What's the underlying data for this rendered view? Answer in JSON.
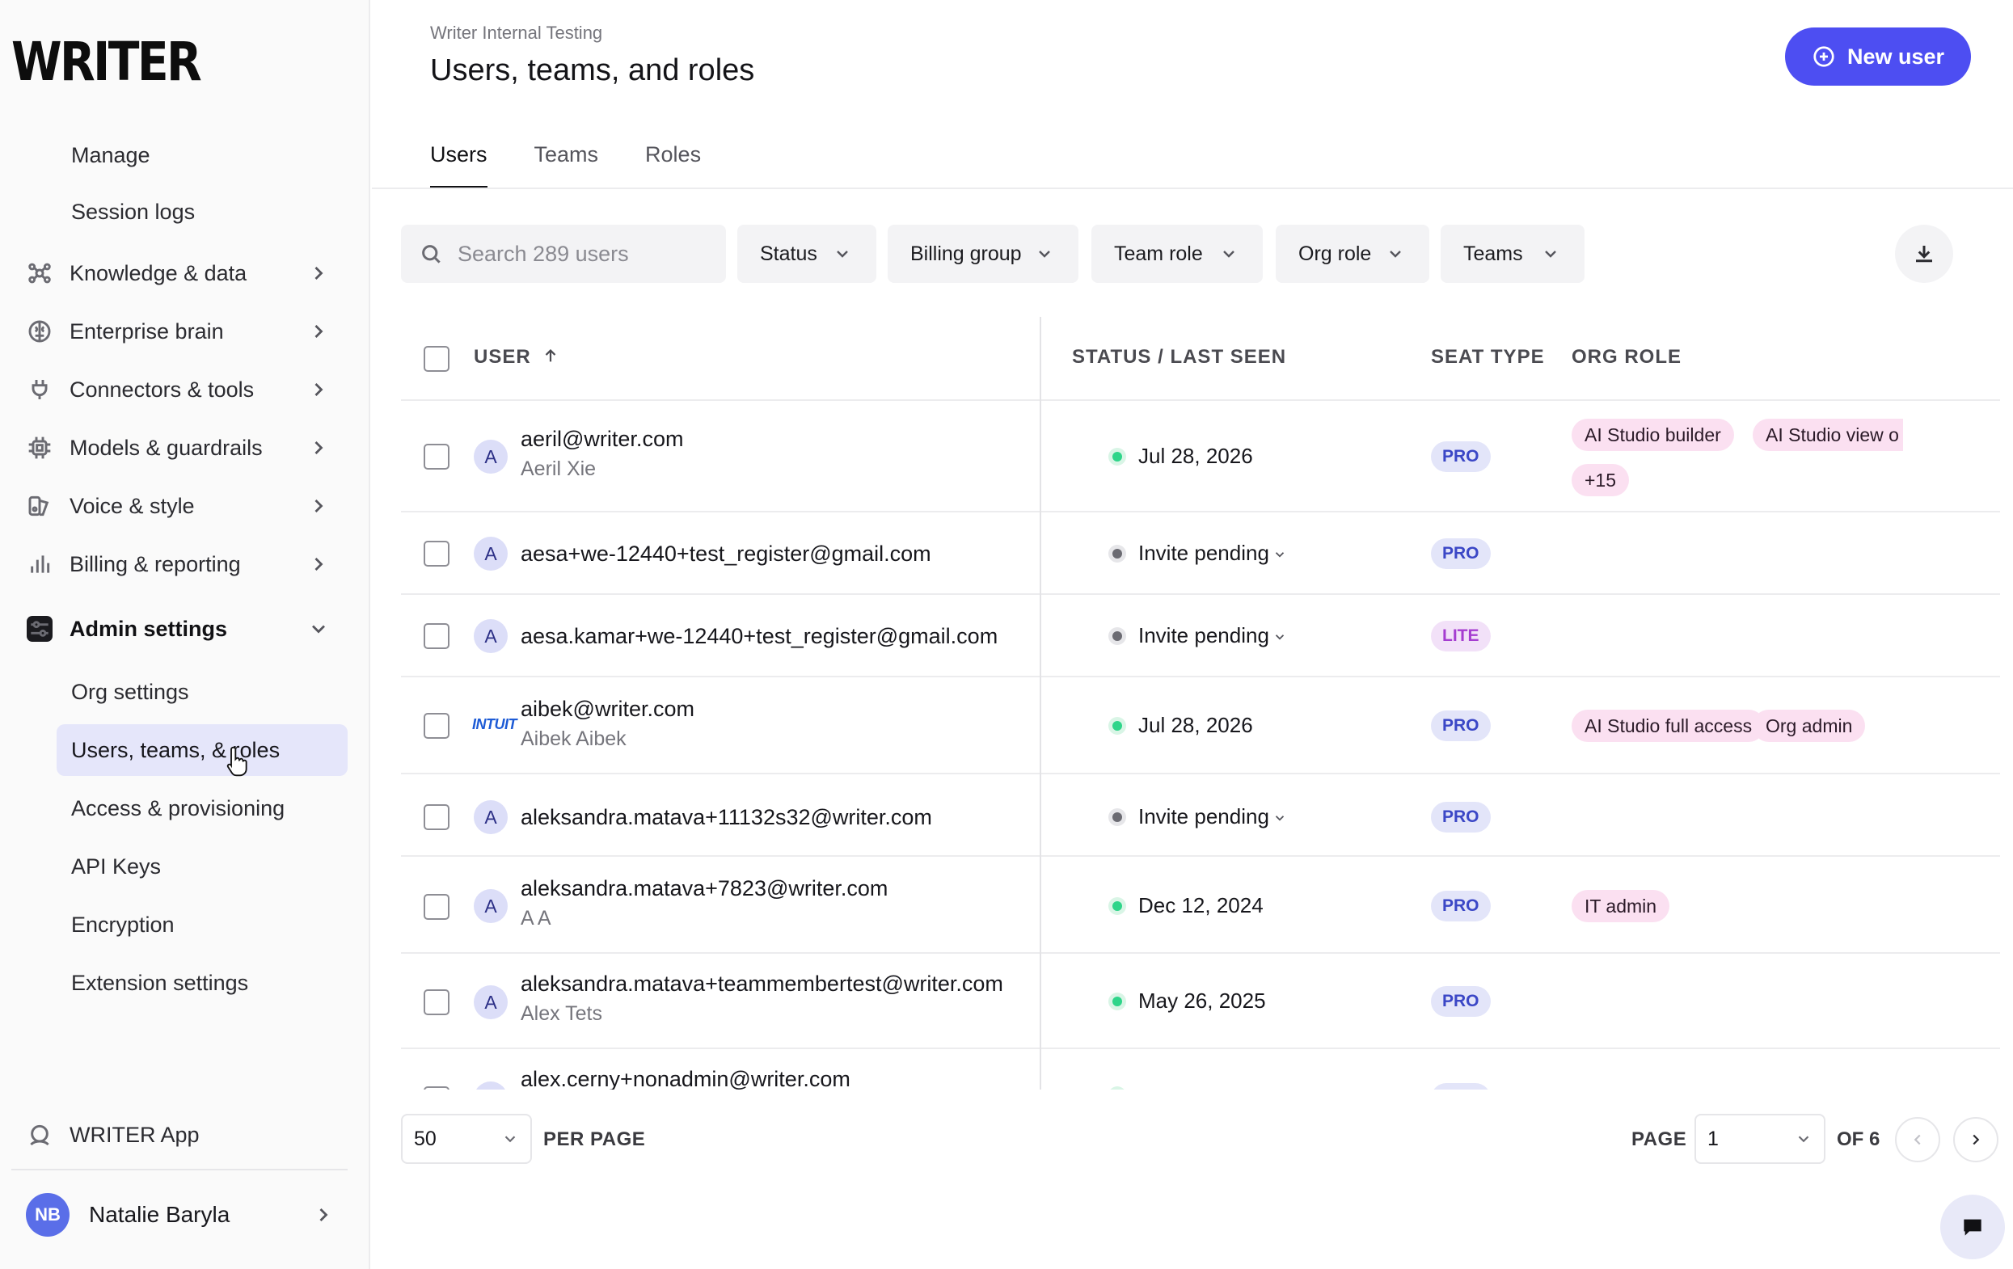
{
  "sidebar": {
    "logo": "WRITER",
    "items": [
      {
        "label": "Manage"
      },
      {
        "label": "Session logs"
      },
      {
        "label": "Knowledge & data",
        "icon": "knowledge-icon"
      },
      {
        "label": "Enterprise brain",
        "icon": "brain-icon"
      },
      {
        "label": "Connectors & tools",
        "icon": "plug-icon"
      },
      {
        "label": "Models & guardrails",
        "icon": "chip-icon"
      },
      {
        "label": "Voice & style",
        "icon": "voice-icon"
      },
      {
        "label": "Billing & reporting",
        "icon": "bar-chart-icon"
      },
      {
        "label": "Admin settings",
        "icon": "sliders-icon"
      }
    ],
    "admin_sub": [
      {
        "label": "Org settings"
      },
      {
        "label": "Users, teams, & roles",
        "active": true
      },
      {
        "label": "Access & provisioning"
      },
      {
        "label": "API Keys"
      },
      {
        "label": "Encryption"
      },
      {
        "label": "Extension settings"
      }
    ],
    "writer_app": "WRITER App",
    "user": {
      "initials": "NB",
      "name": "Natalie Baryla"
    }
  },
  "header": {
    "breadcrumb": "Writer Internal Testing",
    "title": "Users, teams, and roles",
    "new_user_label": "New user"
  },
  "tabs": [
    {
      "label": "Users",
      "active": true
    },
    {
      "label": "Teams"
    },
    {
      "label": "Roles"
    }
  ],
  "filters": {
    "search_placeholder": "Search 289 users",
    "status": "Status",
    "billing_group": "Billing group",
    "team_role": "Team role",
    "org_role": "Org role",
    "teams": "Teams"
  },
  "table": {
    "columns": {
      "user": "USER",
      "status": "STATUS / LAST SEEN",
      "seat": "SEAT TYPE",
      "org_role": "ORG ROLE"
    },
    "rows": [
      {
        "avatar": "A",
        "email": "aeril@writer.com",
        "name": "Aeril Xie",
        "status": "Jul 28, 2026",
        "state": "active",
        "seat": "PRO",
        "roles": [
          "AI Studio builder",
          "AI Studio view o",
          "+15"
        ]
      },
      {
        "avatar": "A",
        "email": "aesa+we-12440+test_register@gmail.com",
        "name": "",
        "status": "Invite pending",
        "state": "pending",
        "seat": "PRO",
        "roles": []
      },
      {
        "avatar": "A",
        "email": "aesa.kamar+we-12440+test_register@gmail.com",
        "name": "",
        "status": "Invite pending",
        "state": "pending",
        "seat": "LITE",
        "roles": []
      },
      {
        "avatar": "INTUIT",
        "email": "aibek@writer.com",
        "name": "Aibek Aibek",
        "status": "Jul 28, 2026",
        "state": "active",
        "seat": "PRO",
        "roles": [
          "AI Studio full access",
          "Org admin"
        ]
      },
      {
        "avatar": "A",
        "email": "aleksandra.matava+11132s32@writer.com",
        "name": "",
        "status": "Invite pending",
        "state": "pending",
        "seat": "PRO",
        "roles": []
      },
      {
        "avatar": "A",
        "email": "aleksandra.matava+7823@writer.com",
        "name": "A A",
        "status": "Dec 12, 2024",
        "state": "active",
        "seat": "PRO",
        "roles": [
          "IT admin"
        ]
      },
      {
        "avatar": "A",
        "email": "aleksandra.matava+teammembertest@writer.com",
        "name": "Alex Tets",
        "status": "May 26, 2025",
        "state": "active",
        "seat": "PRO",
        "roles": []
      },
      {
        "avatar": "A",
        "email": "alex.cerny+nonadmin@writer.com",
        "name": "",
        "status": "",
        "state": "active",
        "seat": "PRO",
        "roles": []
      }
    ]
  },
  "pagination": {
    "per_page_value": "50",
    "per_page_label": "PER PAGE",
    "page_label": "PAGE",
    "page_value": "1",
    "of_label": "OF 6"
  },
  "colors": {
    "accent": "#4d4ef2",
    "active_nav": "#e5e6fa",
    "pro_badge": "#e3e5f9",
    "lite_badge": "#f2e1f8",
    "role_tag": "#fbe0f1",
    "status_active": "#2fd58a"
  }
}
